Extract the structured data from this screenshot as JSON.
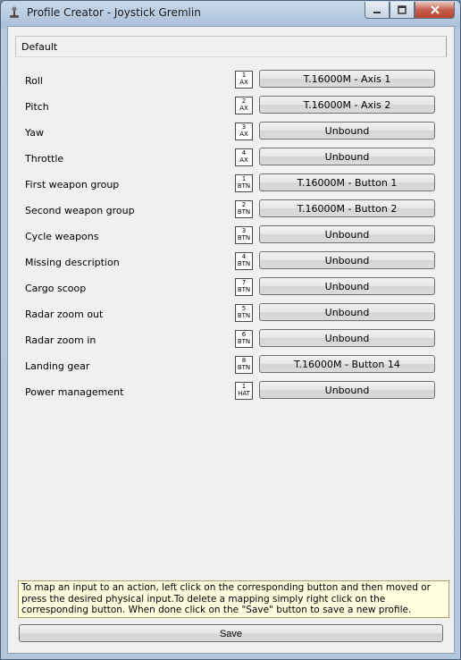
{
  "window": {
    "title": "Profile Creator - Joystick Gremlin",
    "icon": "joystick-icon",
    "controls": {
      "minimize": "—",
      "maximize": "□",
      "close": "✕"
    }
  },
  "profile": {
    "name": "Default"
  },
  "actions": [
    {
      "label": "Roll",
      "input_number": "1",
      "input_type": "AX",
      "binding": "T.16000M - Axis 1"
    },
    {
      "label": "Pitch",
      "input_number": "2",
      "input_type": "AX",
      "binding": "T.16000M - Axis 2"
    },
    {
      "label": "Yaw",
      "input_number": "3",
      "input_type": "AX",
      "binding": "Unbound"
    },
    {
      "label": "Throttle",
      "input_number": "4",
      "input_type": "AX",
      "binding": "Unbound"
    },
    {
      "label": "First weapon group",
      "input_number": "1",
      "input_type": "BTN",
      "binding": "T.16000M - Button 1"
    },
    {
      "label": "Second weapon group",
      "input_number": "2",
      "input_type": "BTN",
      "binding": "T.16000M - Button 2"
    },
    {
      "label": "Cycle weapons",
      "input_number": "3",
      "input_type": "BTN",
      "binding": "Unbound"
    },
    {
      "label": "Missing description",
      "input_number": "4",
      "input_type": "BTN",
      "binding": "Unbound"
    },
    {
      "label": "Cargo scoop",
      "input_number": "7",
      "input_type": "BTN",
      "binding": "Unbound"
    },
    {
      "label": "Radar zoom out",
      "input_number": "5",
      "input_type": "BTN",
      "binding": "Unbound"
    },
    {
      "label": "Radar zoom in",
      "input_number": "6",
      "input_type": "BTN",
      "binding": "Unbound"
    },
    {
      "label": "Landing gear",
      "input_number": "8",
      "input_type": "BTN",
      "binding": "T.16000M - Button 14"
    },
    {
      "label": "Power management",
      "input_number": "1",
      "input_type": "HAT",
      "binding": "Unbound"
    }
  ],
  "help_text": "To map an input to an action, left click on the corresponding button and then moved or press the desired physical input.To delete a mapping simply right click on the corresponding button. When done click on the \"Save\" button to save a new profile.",
  "save_label": "Save"
}
